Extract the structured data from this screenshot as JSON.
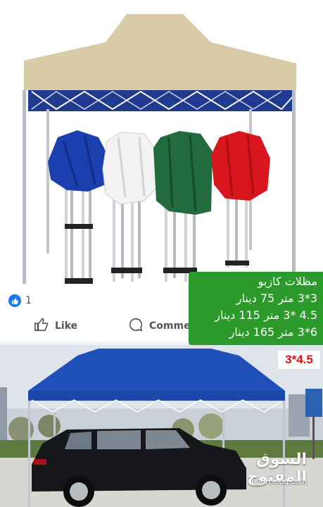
{
  "top_caption": "",
  "reactions": {
    "count": "1"
  },
  "actions": {
    "like_label": "Like",
    "comment_label": "Comment"
  },
  "price_panel": {
    "title": "مظلات كازبو",
    "line1": "3*3 متر 75 دينار",
    "line2": "4.5 *3 متر 115 دينار",
    "line3": "6*3 متر 165 دينار"
  },
  "size_badge": "3*4.5",
  "watermark": {
    "arabic": "السوق المفتوح",
    "english": "opensooq.com"
  },
  "colors": {
    "canopy_top": "#d9cba7",
    "canopy_bottom": "#1f4fb8",
    "panel_green": "#2c9a2a",
    "badge_red": "#e3101a",
    "fb_blue": "#1877f2"
  },
  "folded_canopies": [
    "blue",
    "white",
    "green",
    "red"
  ]
}
